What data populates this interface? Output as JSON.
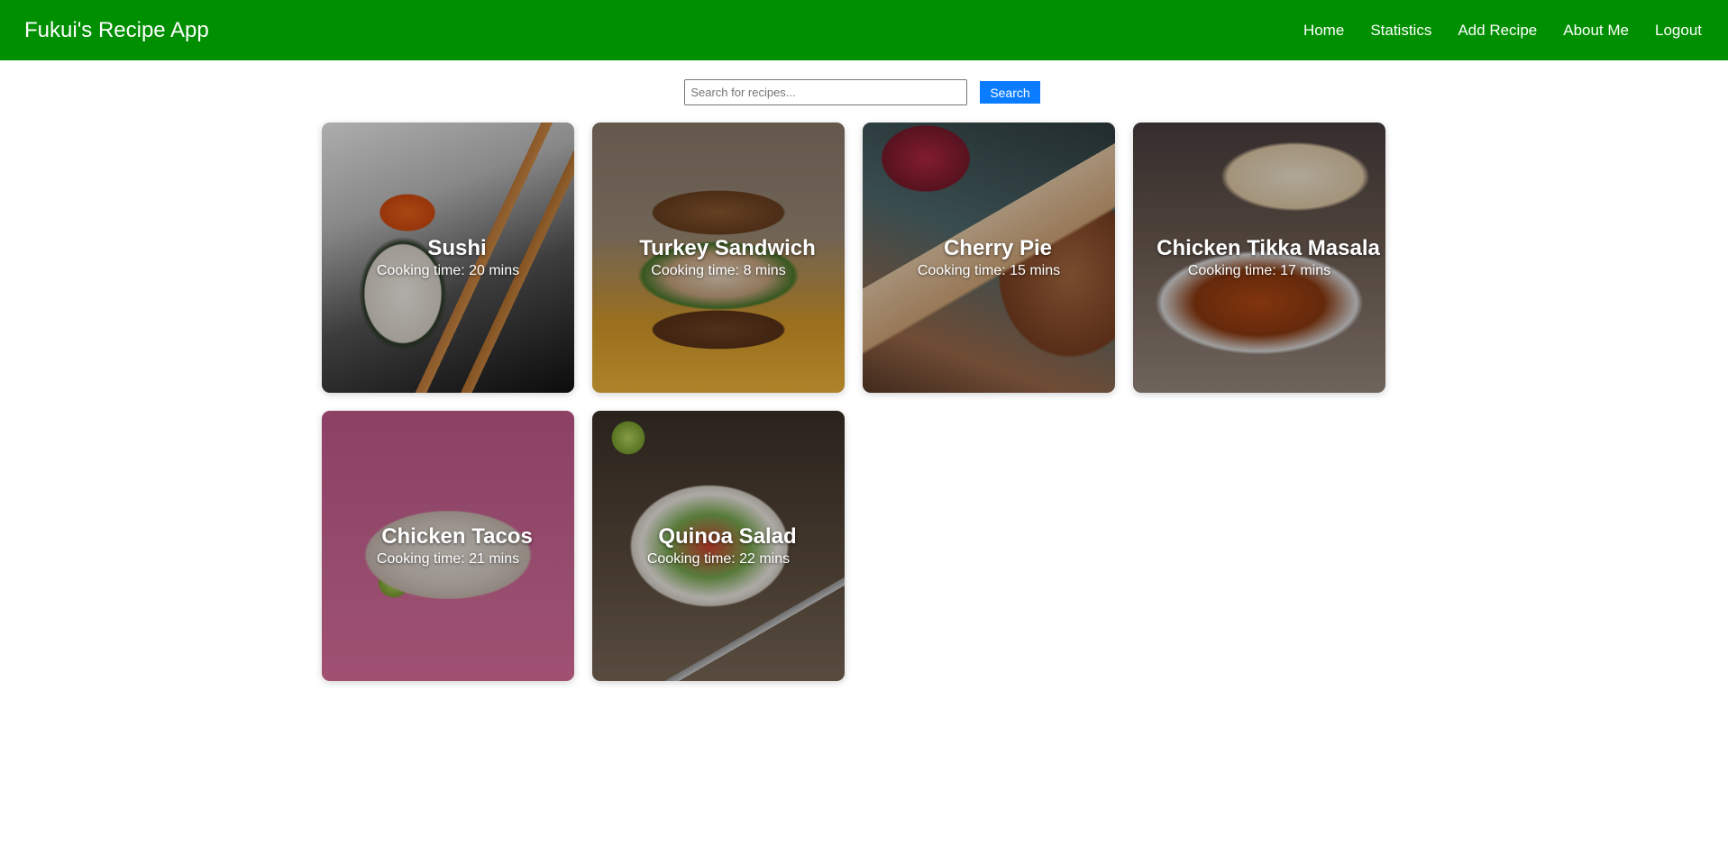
{
  "navbar": {
    "brand": "Fukui's Recipe App",
    "links": [
      "Home",
      "Statistics",
      "Add Recipe",
      "About Me",
      "Logout"
    ]
  },
  "search": {
    "placeholder": "Search for recipes...",
    "value": "",
    "button_label": "Search"
  },
  "recipes": [
    {
      "name": "Sushi",
      "time": "Cooking time: 20 mins"
    },
    {
      "name": "Turkey Sandwich",
      "time": "Cooking time: 8 mins"
    },
    {
      "name": "Cherry Pie",
      "time": "Cooking time: 15 mins"
    },
    {
      "name": "Chicken Tikka Masala",
      "time": "Cooking time: 17 mins"
    },
    {
      "name": "Chicken Tacos",
      "time": "Cooking time: 21 mins"
    },
    {
      "name": "Quinoa Salad",
      "time": "Cooking time: 22 mins"
    }
  ],
  "colors": {
    "navbar": "#008f00",
    "search_button": "#0a7cff"
  }
}
